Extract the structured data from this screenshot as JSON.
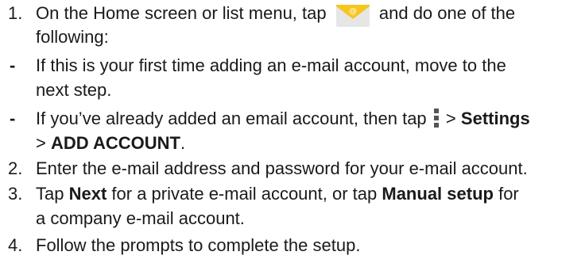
{
  "steps": [
    {
      "marker": "1.",
      "line1_before": "On the Home screen or list menu, tap",
      "line1_after": "and do one of the",
      "line2": "following:",
      "icon": "email-app-icon"
    },
    {
      "marker": "-",
      "line1": "If this is your first time adding an e-mail account, move to the",
      "line2": "next step."
    },
    {
      "marker": "-",
      "line1_before": "If you’ve already added an email account, then tap",
      "icon": "more-options-icon",
      "gt1": ">",
      "settings": "Settings",
      "gt2": ">",
      "add_account": "ADD ACCOUNT",
      "period": "."
    },
    {
      "marker": "2.",
      "line1": "Enter the e-mail address and password for your e-mail account."
    },
    {
      "marker": "3.",
      "tap": "Tap",
      "next": "Next",
      "middle": "for a private e-mail account, or tap",
      "manual": "Manual setup",
      "for": "for",
      "line2": "a company e-mail account."
    },
    {
      "marker": "4.",
      "line1": "Follow the prompts to complete the setup."
    }
  ],
  "colors": {
    "text": "#1a1a1a",
    "icon_envelope": "#e6e6e6",
    "icon_flap": "#f7c51e",
    "icon_symbol": "#ffffff",
    "more_dots": "#555555"
  }
}
